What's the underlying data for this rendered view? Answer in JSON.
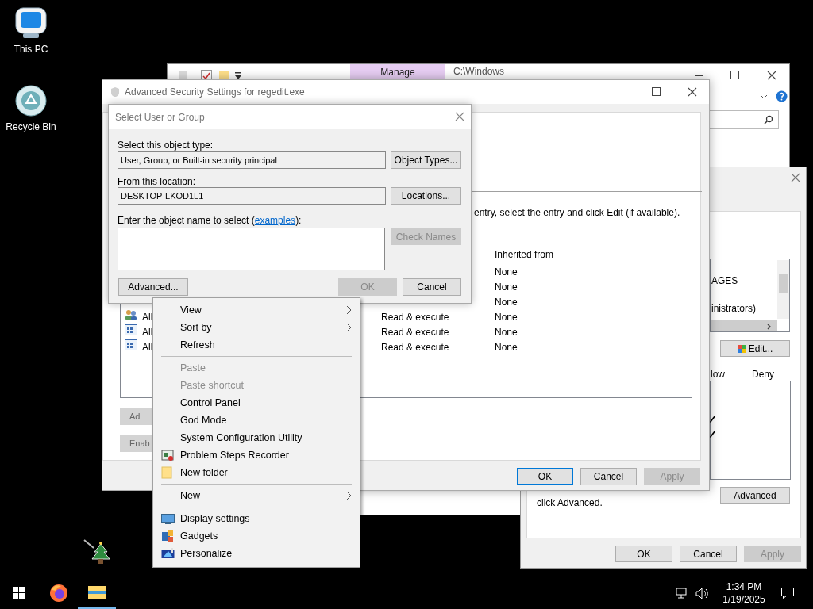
{
  "desktop_icons": [
    {
      "kind": "computer",
      "label": "This PC"
    },
    {
      "kind": "recycle",
      "label": "Recycle Bin"
    }
  ],
  "explorer": {
    "ribbon_tab": "Manage",
    "path": "C:\\Windows"
  },
  "permissions_dialog": {
    "list_items": [
      "AGES",
      "inistrators)"
    ],
    "edit_button": "Edit...",
    "columns": [
      "low",
      "Deny"
    ],
    "allow_checks": [
      {
        "checked": true
      },
      {
        "checked": true
      }
    ],
    "note": "click Advanced.",
    "advanced_button": "Advanced",
    "buttons": [
      {
        "label": "OK",
        "disabled": false
      },
      {
        "label": "Cancel",
        "disabled": false
      },
      {
        "label": "Apply",
        "disabled": true
      }
    ]
  },
  "advanced_security": {
    "title": "Advanced Security Settings for regedit.exe",
    "instruction": "entry, select the entry and click Edit (if available).",
    "column": "Inherited from",
    "rows": [
      {
        "inherited": "None"
      },
      {
        "inherited": "None"
      },
      {
        "inherited": "None"
      },
      {
        "kind": "group",
        "name": "All",
        "access": "Read & execute",
        "inherited": "None"
      },
      {
        "kind": "package",
        "name": "All",
        "access": "Read & execute",
        "inherited": "None"
      },
      {
        "kind": "package",
        "name": "All",
        "access": "Read & execute",
        "inherited": "None"
      }
    ],
    "side_buttons": [
      "Ad",
      "Enab"
    ],
    "buttons": [
      {
        "label": "OK",
        "disabled": false,
        "focused": true
      },
      {
        "label": "Cancel",
        "disabled": false,
        "focused": false
      },
      {
        "label": "Apply",
        "disabled": true,
        "focused": false
      }
    ]
  },
  "select_dialog": {
    "title": "Select User or Group",
    "object_type_label": "Select this object type:",
    "object_type": "User, Group, or Built-in security principal",
    "object_types_button": "Object Types...",
    "location_label": "From this location:",
    "location": "DESKTOP-LKOD1L1",
    "locations_button": "Locations...",
    "name_label": "Enter the object name to select (",
    "name_link": "examples",
    "name_label_end": "):",
    "check_names": {
      "label": "Check Names",
      "disabled": true
    },
    "advanced_button": "Advanced...",
    "ok": {
      "label": "OK",
      "disabled": true
    },
    "cancel": {
      "label": "Cancel",
      "disabled": false
    }
  },
  "context_menu": {
    "items": [
      {
        "kind": "item",
        "label": "View",
        "submenu": true,
        "disabled": false
      },
      {
        "kind": "item",
        "label": "Sort by",
        "submenu": true,
        "disabled": false
      },
      {
        "kind": "item",
        "label": "Refresh",
        "submenu": false,
        "disabled": false
      },
      {
        "kind": "separator"
      },
      {
        "kind": "item",
        "label": "Paste",
        "submenu": false,
        "disabled": true
      },
      {
        "kind": "item",
        "label": "Paste shortcut",
        "submenu": false,
        "disabled": true
      },
      {
        "kind": "item",
        "label": "Control Panel",
        "submenu": false,
        "disabled": false
      },
      {
        "kind": "item",
        "label": "God Mode",
        "submenu": false,
        "disabled": false
      },
      {
        "kind": "item",
        "label": "System Configuration Utility",
        "submenu": false,
        "disabled": false
      },
      {
        "kind": "item",
        "label": "Problem Steps Recorder",
        "submenu": false,
        "disabled": false
      },
      {
        "kind": "item",
        "label": "New folder",
        "submenu": false,
        "disabled": false
      },
      {
        "kind": "separator"
      },
      {
        "kind": "item",
        "label": "New",
        "submenu": true,
        "disabled": false
      },
      {
        "kind": "separator"
      },
      {
        "kind": "item",
        "label": "Display settings",
        "submenu": false,
        "disabled": false
      },
      {
        "kind": "item",
        "label": "Gadgets",
        "submenu": false,
        "disabled": false
      },
      {
        "kind": "item",
        "label": "Personalize",
        "submenu": false,
        "disabled": false
      }
    ]
  },
  "taskbar": {
    "apps": [
      {
        "kind": "firefox",
        "active": false
      },
      {
        "kind": "explorer",
        "active": true
      }
    ],
    "time": "1:34 PM",
    "date": "1/19/2025"
  }
}
